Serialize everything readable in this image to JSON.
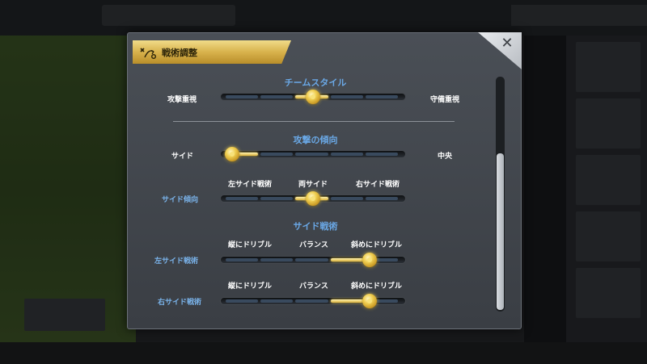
{
  "dialog": {
    "title": "戦術調整",
    "close_label": "✕"
  },
  "team_style": {
    "heading": "チームスタイル",
    "left_label": "攻撃重視",
    "right_label": "守備重視",
    "level": 0.5
  },
  "attack_tendency": {
    "heading": "攻撃の傾向",
    "left_label": "サイド",
    "right_label": "中央",
    "level": 0.0
  },
  "side_tendency": {
    "label": "サイド傾向",
    "options": [
      "左サイド戦術",
      "両サイド",
      "右サイド戦術"
    ],
    "level": 0.5
  },
  "side_tactics": {
    "heading": "サイド戦術",
    "left": {
      "label": "左サイド戦術",
      "options": [
        "縦にドリブル",
        "バランス",
        "斜めにドリブル"
      ],
      "level": 0.85
    },
    "right": {
      "label": "右サイド戦術",
      "options": [
        "縦にドリブル",
        "バランス",
        "斜めにドリブル"
      ],
      "level": 0.85
    }
  }
}
